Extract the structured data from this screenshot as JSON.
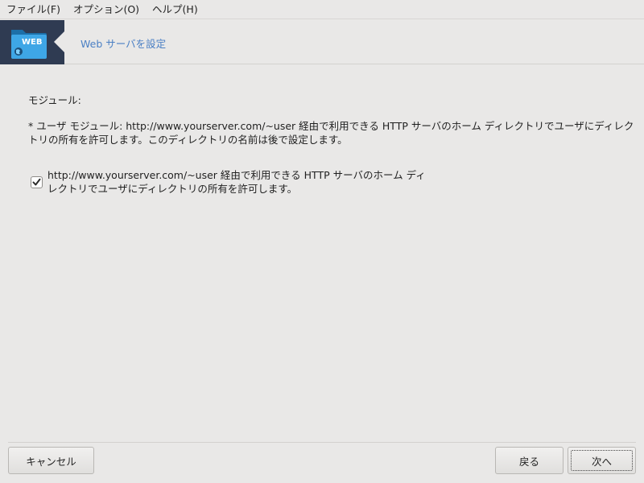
{
  "menubar": {
    "items": [
      {
        "label": "ファイル(F)"
      },
      {
        "label": "オプション(O)"
      },
      {
        "label": "ヘルプ(H)"
      }
    ]
  },
  "header": {
    "icon_text": "WEB",
    "title": "Web サーバを設定"
  },
  "main": {
    "modules_label": "モジュール:",
    "description": "* ユーザ モジュール: http://www.yourserver.com/~user 経由で利用できる HTTP サーバのホーム ディレクトリでユーザにディレクトリの所有を許可します。このディレクトリの名前は後で設定します。",
    "checkbox": {
      "checked": true,
      "label": "http://www.yourserver.com/~user 経由で利用できる HTTP サーバのホーム ディレクトリでユーザにディレクトリの所有を許可します。"
    }
  },
  "footer": {
    "cancel_label": "キャンセル",
    "back_label": "戻る",
    "next_label": "次へ"
  },
  "colors": {
    "accent": "#4a7fc4",
    "banner": "#2f3b52",
    "background": "#e9e8e7"
  }
}
